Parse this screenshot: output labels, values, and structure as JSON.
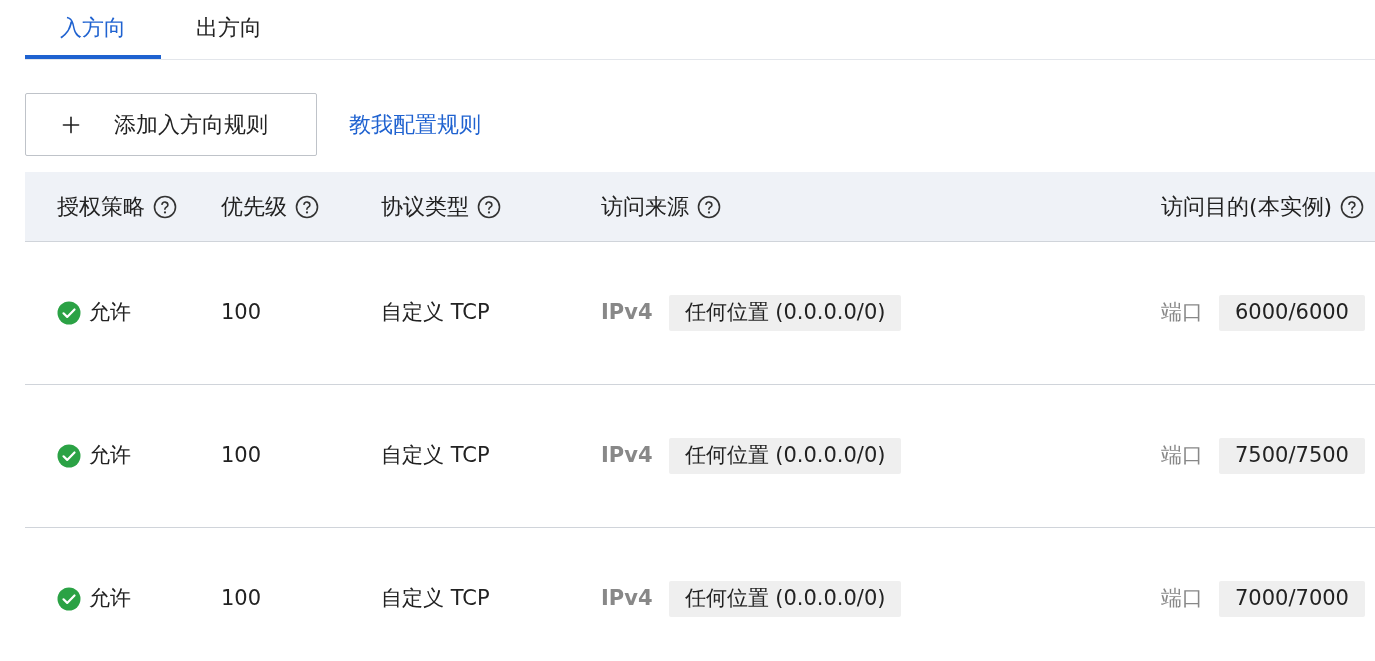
{
  "tabs": [
    {
      "label": "入方向",
      "selected": true
    },
    {
      "label": "出方向",
      "selected": false
    }
  ],
  "toolbar": {
    "add_button": "添加入方向规则",
    "help_link": "教我配置规则"
  },
  "table": {
    "columns": [
      "授权策略",
      "优先级",
      "协议类型",
      "访问来源",
      "访问目的(本实例)"
    ],
    "rows": [
      {
        "policy": {
          "kind": "allow",
          "label": "允许"
        },
        "priority": "100",
        "protocol": "自定义 TCP",
        "source_type": "IPv4",
        "source": "任何位置 (0.0.0.0/0)",
        "dest_label": "端口",
        "dest": "6000/6000"
      },
      {
        "policy": {
          "kind": "allow",
          "label": "允许"
        },
        "priority": "100",
        "protocol": "自定义 TCP",
        "source_type": "IPv4",
        "source": "任何位置 (0.0.0.0/0)",
        "dest_label": "端口",
        "dest": "7500/7500"
      },
      {
        "policy": {
          "kind": "allow",
          "label": "允许"
        },
        "priority": "100",
        "protocol": "自定义 TCP",
        "source_type": "IPv4",
        "source": "任何位置 (0.0.0.0/0)",
        "dest_label": "端口",
        "dest": "7000/7000"
      }
    ]
  }
}
